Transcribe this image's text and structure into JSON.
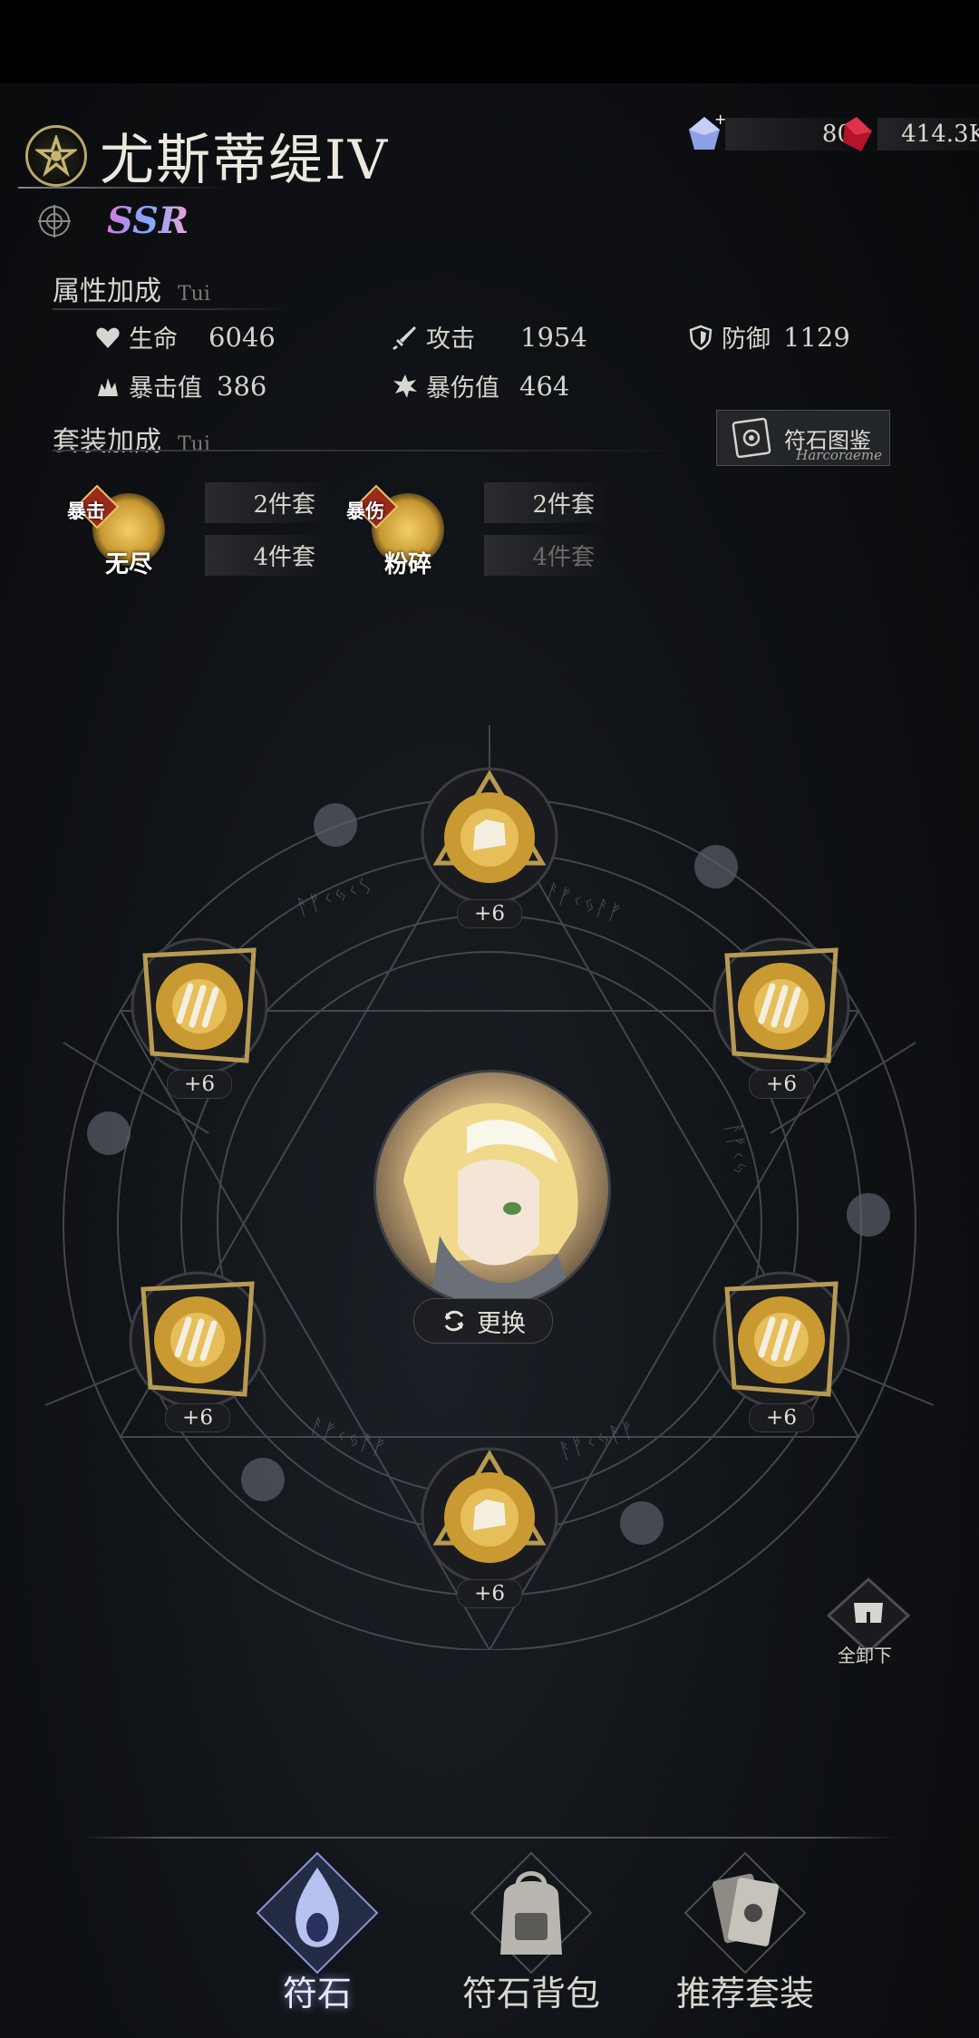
{
  "header": {
    "character_name": "尤斯蒂缇IV",
    "rarity": "SSR",
    "currencies": [
      {
        "icon": "crystal-gem-icon",
        "value": "80",
        "has_add": true
      },
      {
        "icon": "red-ruby-icon",
        "value": "414.3K"
      }
    ]
  },
  "attributes": {
    "title": "属性加成",
    "sub": "Tui",
    "stats": [
      {
        "icon": "heart-icon",
        "label": "生命",
        "value": "6046"
      },
      {
        "icon": "sword-icon",
        "label": "攻击",
        "value": "1954"
      },
      {
        "icon": "shield-icon",
        "label": "防御",
        "value": "1129"
      },
      {
        "icon": "crit-flame-icon",
        "label": "暴击值",
        "value": "386"
      },
      {
        "icon": "crit-damage-icon",
        "label": "暴伤值",
        "value": "464"
      }
    ]
  },
  "codex_button": {
    "label": "符石图鉴",
    "sub": "Harcoraeme"
  },
  "sets": {
    "title": "套装加成",
    "sub": "Tui",
    "items": [
      {
        "tag": "暴击",
        "name": "无尽",
        "bonus2": "2件套",
        "bonus4": "4件套",
        "active4": true
      },
      {
        "tag": "暴伤",
        "name": "粉碎",
        "bonus2": "2件套",
        "bonus4": "4件套",
        "active4": false
      }
    ]
  },
  "slots": [
    {
      "position": "top",
      "rune": "fist-rune",
      "level": "+6"
    },
    {
      "position": "upper-right",
      "rune": "claw-rune",
      "level": "+6"
    },
    {
      "position": "lower-right",
      "rune": "claw-rune",
      "level": "+6"
    },
    {
      "position": "bottom",
      "rune": "fist-rune",
      "level": "+6"
    },
    {
      "position": "lower-left",
      "rune": "claw-rune",
      "level": "+6"
    },
    {
      "position": "upper-left",
      "rune": "claw-rune",
      "level": "+6"
    }
  ],
  "change_button": {
    "label": "更换"
  },
  "unequip_button": {
    "label": "全卸下"
  },
  "nav": [
    {
      "label": "符石",
      "active": true
    },
    {
      "label": "符石背包",
      "active": false
    },
    {
      "label": "推荐套装",
      "active": false
    }
  ],
  "colors": {
    "gold": "#c99a32",
    "panel": "#1d1e21",
    "accent_blue": "#7a8ad0"
  }
}
